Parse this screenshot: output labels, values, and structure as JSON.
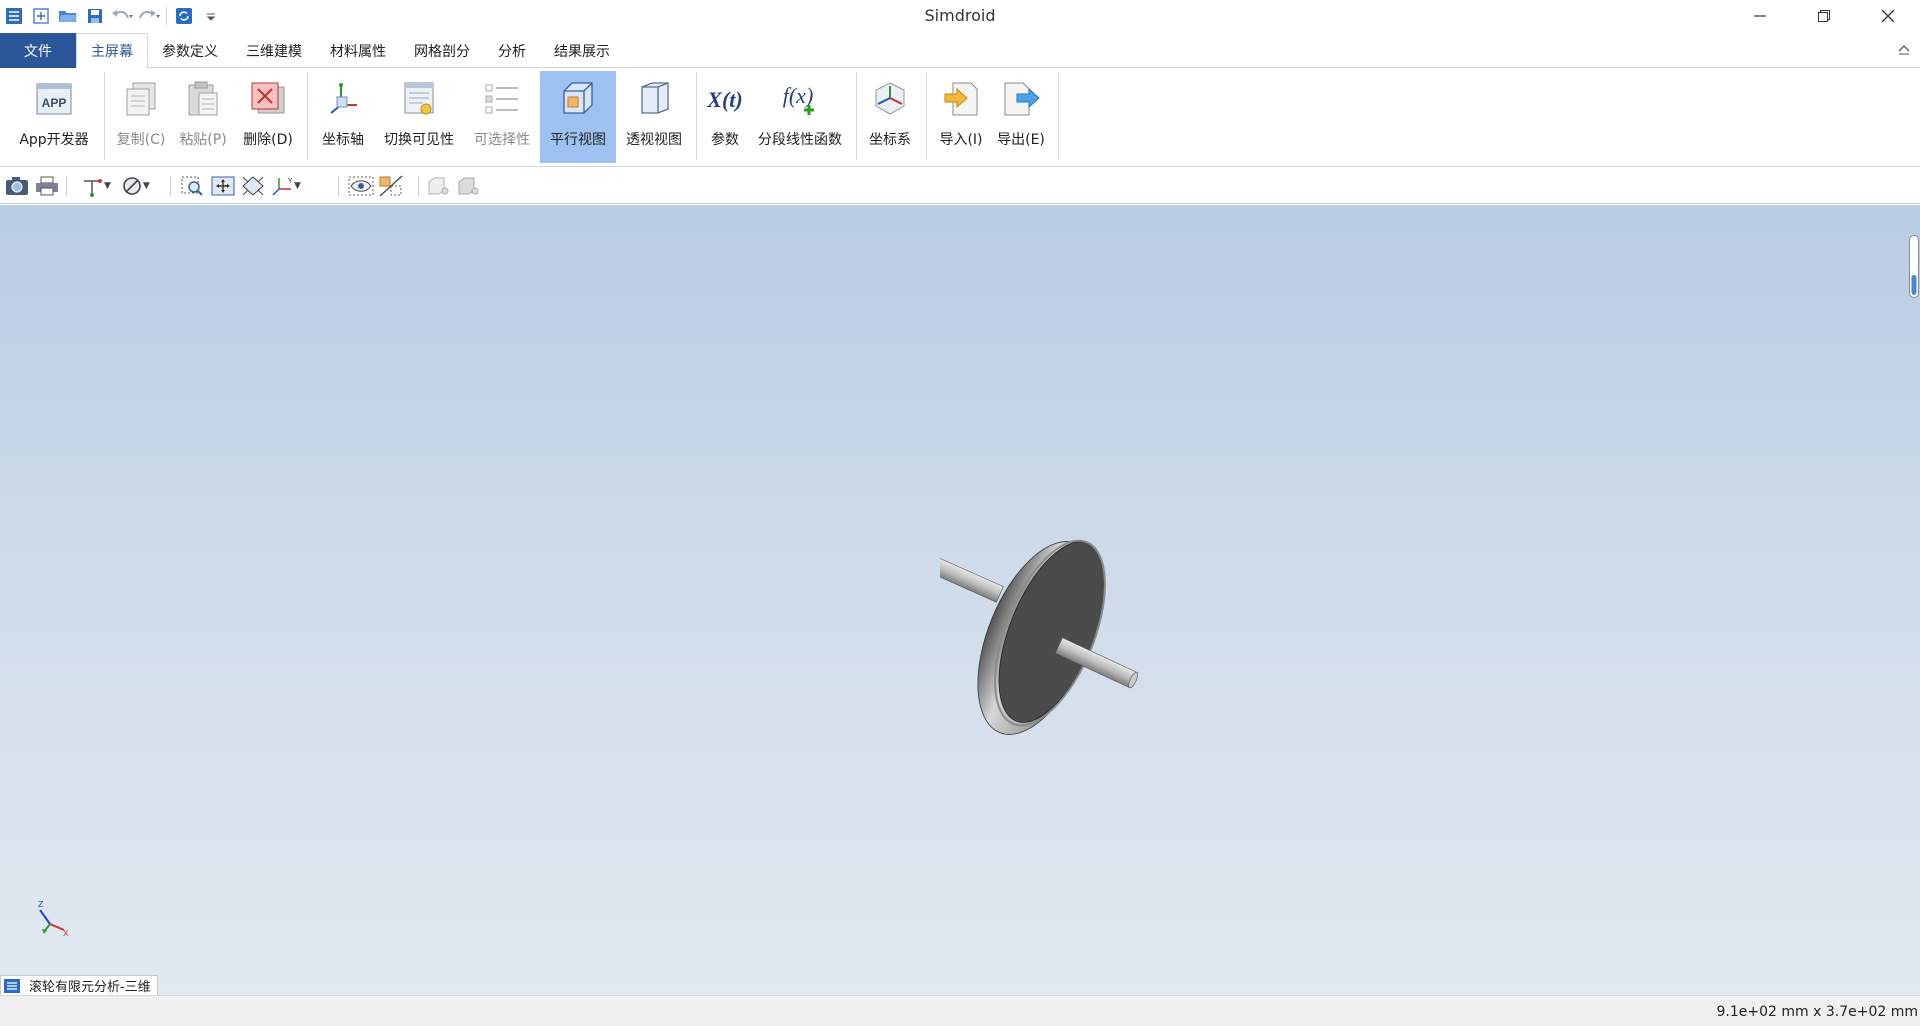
{
  "app": {
    "title": "Simdroid"
  },
  "quick_access": {
    "icons": [
      "app-logo-icon",
      "new-file-icon",
      "open-folder-icon",
      "save-icon",
      "undo-icon",
      "redo-icon",
      "refresh-icon",
      "customize-dropdown-icon"
    ]
  },
  "menu": {
    "file_label": "文件",
    "tabs": [
      {
        "label": "主屏幕",
        "active": true
      },
      {
        "label": "参数定义",
        "active": false
      },
      {
        "label": "三维建模",
        "active": false
      },
      {
        "label": "材料属性",
        "active": false
      },
      {
        "label": "网格剖分",
        "active": false
      },
      {
        "label": "分析",
        "active": false
      },
      {
        "label": "结果展示",
        "active": false
      }
    ]
  },
  "ribbon": {
    "app_dev": "App开发器",
    "app_icon_text": "APP",
    "copy": "复制(C)",
    "paste": "粘贴(P)",
    "delete": "删除(D)",
    "axes": "坐标轴",
    "toggle_visibility": "切换可见性",
    "selectable": "可选择性",
    "parallel_view": "平行视图",
    "perspective_view": "透视视图",
    "parameters": "参数",
    "param_icon_text": "X(t)",
    "piecewise_func": "分段线性函数",
    "func_icon_text": "f(x)",
    "coord_system": "坐标系",
    "import": "导入(I)",
    "export": "导出(E)"
  },
  "document": {
    "tab_label": "滚轮有限元分析-三维"
  },
  "status": {
    "dimensions": "9.1e+02 mm x 3.7e+02 mm"
  },
  "triad": {
    "z": "Z",
    "x": "X"
  },
  "colors": {
    "accent": "#2b579a",
    "selected": "#9dc1f0",
    "viewport_top": "#b9cde3",
    "viewport_bottom": "#e2e9f1"
  }
}
